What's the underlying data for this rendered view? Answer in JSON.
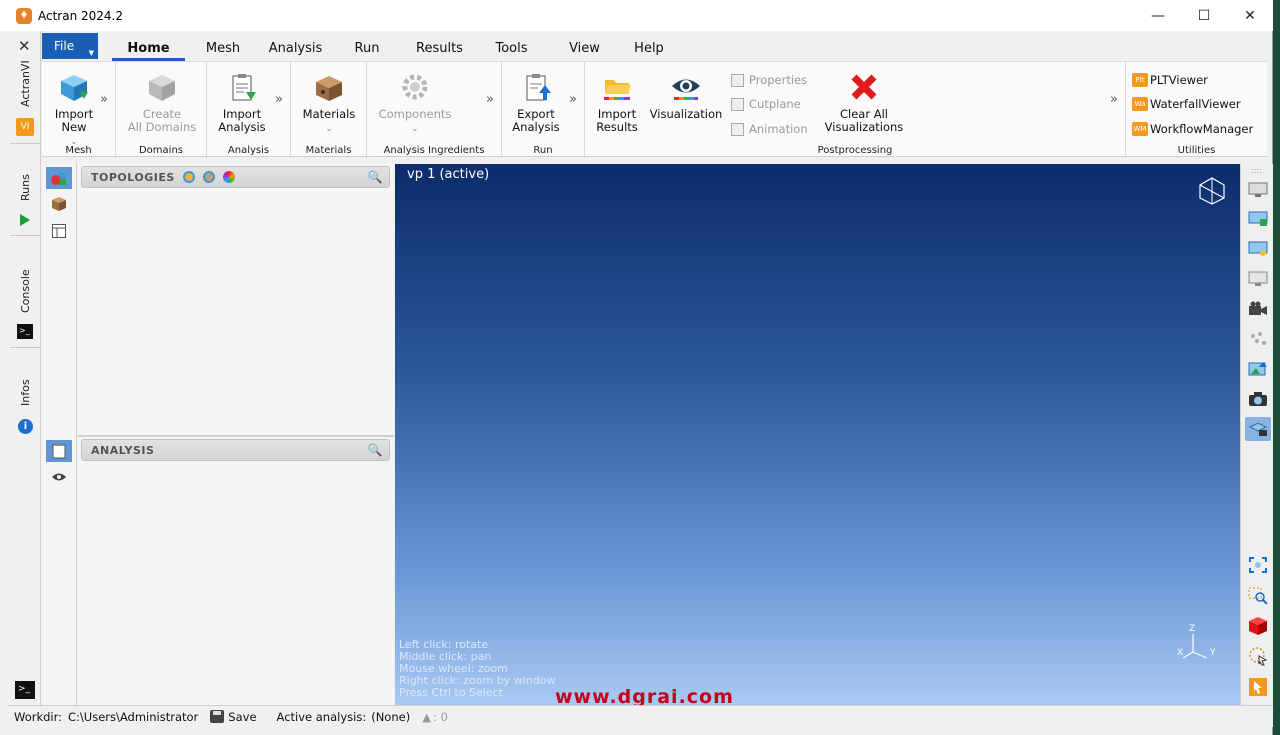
{
  "window": {
    "title": "Actran 2024.2"
  },
  "left_strip": {
    "tabs": [
      "ActranVI",
      "Runs",
      "Console",
      "Infos"
    ],
    "badge": "VI"
  },
  "menu": {
    "file_label": "File",
    "items": [
      "Home",
      "Mesh",
      "Analysis",
      "Run",
      "Results",
      "Tools",
      "View",
      "Help"
    ]
  },
  "ribbon": {
    "mesh": {
      "import_new_1": "Import",
      "import_new_2": "New",
      "group": "Mesh"
    },
    "domains": {
      "create_1": "Create",
      "create_2": "All Domains",
      "group": "Domains"
    },
    "analysis": {
      "import_1": "Import",
      "import_2": "Analysis",
      "group": "Analysis"
    },
    "materials": {
      "label": "Materials",
      "group": "Materials"
    },
    "ingredients": {
      "components": "Components",
      "group": "Analysis Ingredients"
    },
    "run": {
      "export_1": "Export",
      "export_2": "Analysis",
      "group": "Run"
    },
    "post": {
      "import_1": "Import",
      "import_2": "Results",
      "visualization": "Visualization",
      "properties": "Properties",
      "cutplane": "Cutplane",
      "animation": "Animation",
      "clear_1": "Clear All",
      "clear_2": "Visualizations",
      "group": "Postprocessing"
    },
    "utilities": {
      "items": [
        {
          "badge": "Plt",
          "label": "PLTViewer"
        },
        {
          "badge": "Wa",
          "label": "WaterfallViewer"
        },
        {
          "badge": "WM",
          "label": "WorkflowManager"
        }
      ],
      "group": "Utilities"
    }
  },
  "panels": {
    "topologies": "TOPOLOGIES",
    "analysis": "ANALYSIS"
  },
  "viewport": {
    "title": "vp 1 (active)",
    "hints": [
      "Left click: rotate",
      "Middle click: pan",
      "Mouse wheel: zoom",
      "Right click: zoom by window",
      "Press Ctrl to Select"
    ],
    "watermark": "www.dgrai.com",
    "axes": {
      "x": "X",
      "y": "Y",
      "z": "Z"
    }
  },
  "status": {
    "workdir_label": "Workdir:",
    "workdir": "C:\\Users\\Administrator",
    "save": "Save",
    "active_label": "Active analysis:",
    "active": "(None)",
    "warnings": ": 0"
  },
  "colors": {
    "accent": "#1a5fb4",
    "badge": "#f39a1d",
    "viewport_top": "#0c2c6b",
    "viewport_bottom": "#a9c9f2"
  }
}
